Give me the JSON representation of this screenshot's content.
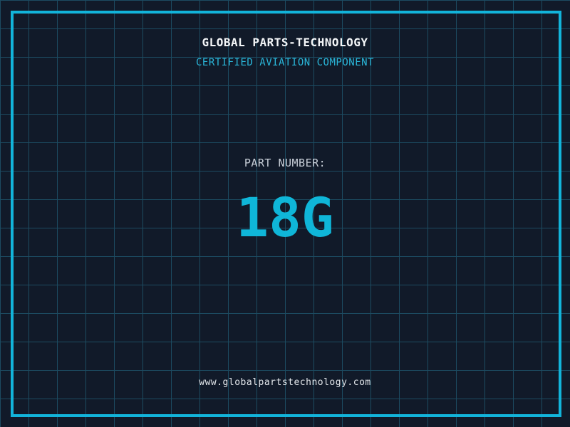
{
  "document": {
    "title": "GLOBAL PARTS-TECHNOLOGY",
    "subtitle": "CERTIFIED AVIATION COMPONENT",
    "part_number_label": "PART NUMBER:",
    "part_number_value": "18G",
    "website": "www.globalpartstechnology.com"
  },
  "style": {
    "background_color": "#111a29",
    "grid_line_color": "#1c4b61",
    "frame_color": "#12b4da",
    "title_color": "#f4f6f8",
    "subtitle_color": "#2ab7da",
    "part_label_color": "#c9d0d9",
    "part_number_color": "#0fb6d8",
    "url_color": "#e4e8ec",
    "grid_cell_size_px": 40
  }
}
